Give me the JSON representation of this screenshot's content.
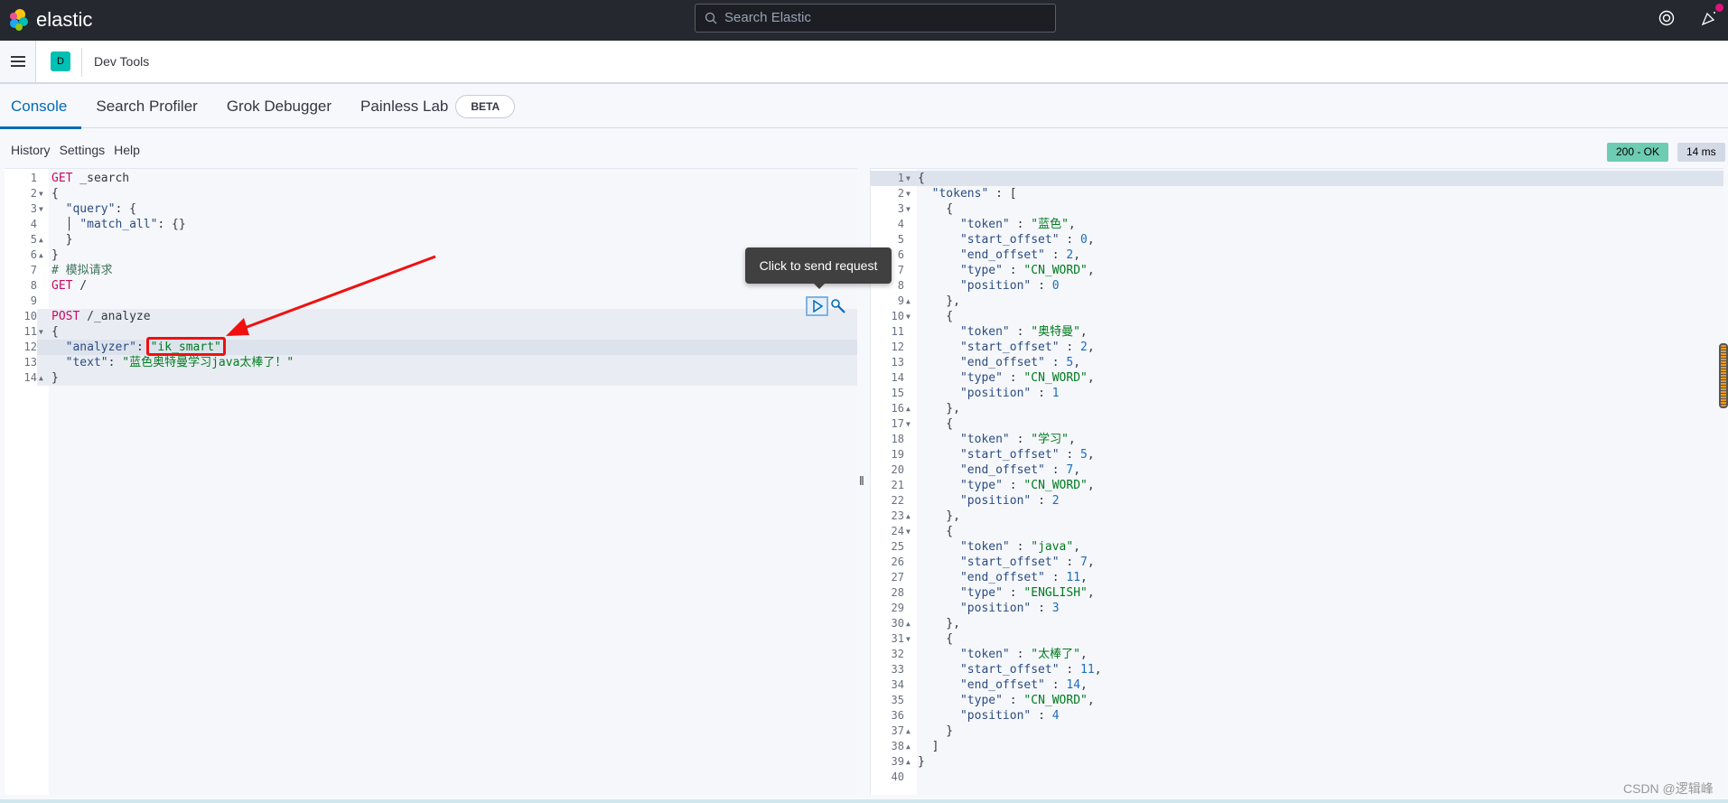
{
  "header": {
    "brand": "elastic",
    "search_placeholder": "Search Elastic"
  },
  "subbar": {
    "space_initial": "D",
    "breadcrumb": "Dev Tools"
  },
  "tabs": [
    {
      "label": "Console"
    },
    {
      "label": "Search Profiler"
    },
    {
      "label": "Grok Debugger"
    },
    {
      "label": "Painless Lab"
    }
  ],
  "beta_badge": "BETA",
  "toolbar": {
    "history": "History",
    "settings": "Settings",
    "help": "Help"
  },
  "response_status": {
    "status": "200 - OK",
    "time": "14 ms",
    "status_color": "#6dccb1"
  },
  "tooltip": "Click to send request",
  "watermark": "CSDN @逻辑峰",
  "request_lines": [
    {
      "n": "1",
      "t": [
        [
          "method",
          "GET"
        ],
        [
          "path",
          " _search"
        ]
      ]
    },
    {
      "n": "2",
      "f": "open",
      "t": [
        [
          "punc",
          "{"
        ]
      ]
    },
    {
      "n": "3",
      "f": "open",
      "t": [
        [
          "punc",
          "  "
        ],
        [
          "key",
          "\"query\""
        ],
        [
          "punc",
          ": {"
        ]
      ]
    },
    {
      "n": "4",
      "t": [
        [
          "punc",
          "  │ "
        ],
        [
          "key",
          "\"match_all\""
        ],
        [
          "punc",
          ": {}"
        ]
      ]
    },
    {
      "n": "5",
      "f": "close",
      "t": [
        [
          "punc",
          "  }"
        ]
      ]
    },
    {
      "n": "6",
      "f": "close",
      "t": [
        [
          "punc",
          "}"
        ]
      ]
    },
    {
      "n": "7",
      "t": [
        [
          "cmt",
          "# 模拟请求"
        ]
      ]
    },
    {
      "n": "8",
      "t": [
        [
          "method",
          "GET"
        ],
        [
          "path",
          " /"
        ]
      ]
    },
    {
      "n": "9",
      "t": []
    },
    {
      "n": "10",
      "hl": "band",
      "t": [
        [
          "method",
          "POST"
        ],
        [
          "path",
          " /_analyze"
        ]
      ]
    },
    {
      "n": "11",
      "hl": "band",
      "f": "open",
      "t": [
        [
          "punc",
          "{"
        ]
      ]
    },
    {
      "n": "12",
      "hl": "cur",
      "t": [
        [
          "punc",
          "  "
        ],
        [
          "key",
          "\"analyzer\""
        ],
        [
          "punc",
          ": "
        ],
        [
          "str",
          "\"ik_smart\""
        ],
        [
          "punc",
          ","
        ]
      ]
    },
    {
      "n": "13",
      "hl": "band",
      "t": [
        [
          "punc",
          "  "
        ],
        [
          "key",
          "\"text\""
        ],
        [
          "punc",
          ": "
        ],
        [
          "str",
          "\"蓝色奥特曼学习java太棒了！\""
        ]
      ]
    },
    {
      "n": "14",
      "hl": "band",
      "f": "close",
      "t": [
        [
          "punc",
          "}"
        ]
      ]
    }
  ],
  "response_lines": [
    {
      "n": "1",
      "f": "open",
      "hl": "cur",
      "t": [
        [
          "punc",
          "{"
        ]
      ]
    },
    {
      "n": "2",
      "f": "open",
      "t": [
        [
          "punc",
          "  "
        ],
        [
          "key",
          "\"tokens\""
        ],
        [
          "punc",
          " : ["
        ]
      ]
    },
    {
      "n": "3",
      "f": "open",
      "t": [
        [
          "punc",
          "    {"
        ]
      ]
    },
    {
      "n": "4",
      "t": [
        [
          "punc",
          "      "
        ],
        [
          "key",
          "\"token\""
        ],
        [
          "punc",
          " : "
        ],
        [
          "str",
          "\"蓝色\""
        ],
        [
          "punc",
          ","
        ]
      ]
    },
    {
      "n": "5",
      "t": [
        [
          "punc",
          "      "
        ],
        [
          "key",
          "\"start_offset\""
        ],
        [
          "punc",
          " : "
        ],
        [
          "num",
          "0"
        ],
        [
          "punc",
          ","
        ]
      ]
    },
    {
      "n": "6",
      "t": [
        [
          "punc",
          "      "
        ],
        [
          "key",
          "\"end_offset\""
        ],
        [
          "punc",
          " : "
        ],
        [
          "num",
          "2"
        ],
        [
          "punc",
          ","
        ]
      ]
    },
    {
      "n": "7",
      "t": [
        [
          "punc",
          "      "
        ],
        [
          "key",
          "\"type\""
        ],
        [
          "punc",
          " : "
        ],
        [
          "str",
          "\"CN_WORD\""
        ],
        [
          "punc",
          ","
        ]
      ]
    },
    {
      "n": "8",
      "t": [
        [
          "punc",
          "      "
        ],
        [
          "key",
          "\"position\""
        ],
        [
          "punc",
          " : "
        ],
        [
          "num",
          "0"
        ]
      ]
    },
    {
      "n": "9",
      "f": "close",
      "t": [
        [
          "punc",
          "    },"
        ]
      ]
    },
    {
      "n": "10",
      "f": "open",
      "t": [
        [
          "punc",
          "    {"
        ]
      ]
    },
    {
      "n": "11",
      "t": [
        [
          "punc",
          "      "
        ],
        [
          "key",
          "\"token\""
        ],
        [
          "punc",
          " : "
        ],
        [
          "str",
          "\"奥特曼\""
        ],
        [
          "punc",
          ","
        ]
      ]
    },
    {
      "n": "12",
      "t": [
        [
          "punc",
          "      "
        ],
        [
          "key",
          "\"start_offset\""
        ],
        [
          "punc",
          " : "
        ],
        [
          "num",
          "2"
        ],
        [
          "punc",
          ","
        ]
      ]
    },
    {
      "n": "13",
      "t": [
        [
          "punc",
          "      "
        ],
        [
          "key",
          "\"end_offset\""
        ],
        [
          "punc",
          " : "
        ],
        [
          "num",
          "5"
        ],
        [
          "punc",
          ","
        ]
      ]
    },
    {
      "n": "14",
      "t": [
        [
          "punc",
          "      "
        ],
        [
          "key",
          "\"type\""
        ],
        [
          "punc",
          " : "
        ],
        [
          "str",
          "\"CN_WORD\""
        ],
        [
          "punc",
          ","
        ]
      ]
    },
    {
      "n": "15",
      "t": [
        [
          "punc",
          "      "
        ],
        [
          "key",
          "\"position\""
        ],
        [
          "punc",
          " : "
        ],
        [
          "num",
          "1"
        ]
      ]
    },
    {
      "n": "16",
      "f": "close",
      "t": [
        [
          "punc",
          "    },"
        ]
      ]
    },
    {
      "n": "17",
      "f": "open",
      "t": [
        [
          "punc",
          "    {"
        ]
      ]
    },
    {
      "n": "18",
      "t": [
        [
          "punc",
          "      "
        ],
        [
          "key",
          "\"token\""
        ],
        [
          "punc",
          " : "
        ],
        [
          "str",
          "\"学习\""
        ],
        [
          "punc",
          ","
        ]
      ]
    },
    {
      "n": "19",
      "t": [
        [
          "punc",
          "      "
        ],
        [
          "key",
          "\"start_offset\""
        ],
        [
          "punc",
          " : "
        ],
        [
          "num",
          "5"
        ],
        [
          "punc",
          ","
        ]
      ]
    },
    {
      "n": "20",
      "t": [
        [
          "punc",
          "      "
        ],
        [
          "key",
          "\"end_offset\""
        ],
        [
          "punc",
          " : "
        ],
        [
          "num",
          "7"
        ],
        [
          "punc",
          ","
        ]
      ]
    },
    {
      "n": "21",
      "t": [
        [
          "punc",
          "      "
        ],
        [
          "key",
          "\"type\""
        ],
        [
          "punc",
          " : "
        ],
        [
          "str",
          "\"CN_WORD\""
        ],
        [
          "punc",
          ","
        ]
      ]
    },
    {
      "n": "22",
      "t": [
        [
          "punc",
          "      "
        ],
        [
          "key",
          "\"position\""
        ],
        [
          "punc",
          " : "
        ],
        [
          "num",
          "2"
        ]
      ]
    },
    {
      "n": "23",
      "f": "close",
      "t": [
        [
          "punc",
          "    },"
        ]
      ]
    },
    {
      "n": "24",
      "f": "open",
      "t": [
        [
          "punc",
          "    {"
        ]
      ]
    },
    {
      "n": "25",
      "t": [
        [
          "punc",
          "      "
        ],
        [
          "key",
          "\"token\""
        ],
        [
          "punc",
          " : "
        ],
        [
          "str",
          "\"java\""
        ],
        [
          "punc",
          ","
        ]
      ]
    },
    {
      "n": "26",
      "t": [
        [
          "punc",
          "      "
        ],
        [
          "key",
          "\"start_offset\""
        ],
        [
          "punc",
          " : "
        ],
        [
          "num",
          "7"
        ],
        [
          "punc",
          ","
        ]
      ]
    },
    {
      "n": "27",
      "t": [
        [
          "punc",
          "      "
        ],
        [
          "key",
          "\"end_offset\""
        ],
        [
          "punc",
          " : "
        ],
        [
          "num",
          "11"
        ],
        [
          "punc",
          ","
        ]
      ]
    },
    {
      "n": "28",
      "t": [
        [
          "punc",
          "      "
        ],
        [
          "key",
          "\"type\""
        ],
        [
          "punc",
          " : "
        ],
        [
          "str",
          "\"ENGLISH\""
        ],
        [
          "punc",
          ","
        ]
      ]
    },
    {
      "n": "29",
      "t": [
        [
          "punc",
          "      "
        ],
        [
          "key",
          "\"position\""
        ],
        [
          "punc",
          " : "
        ],
        [
          "num",
          "3"
        ]
      ]
    },
    {
      "n": "30",
      "f": "close",
      "t": [
        [
          "punc",
          "    },"
        ]
      ]
    },
    {
      "n": "31",
      "f": "open",
      "t": [
        [
          "punc",
          "    {"
        ]
      ]
    },
    {
      "n": "32",
      "t": [
        [
          "punc",
          "      "
        ],
        [
          "key",
          "\"token\""
        ],
        [
          "punc",
          " : "
        ],
        [
          "str",
          "\"太棒了\""
        ],
        [
          "punc",
          ","
        ]
      ]
    },
    {
      "n": "33",
      "t": [
        [
          "punc",
          "      "
        ],
        [
          "key",
          "\"start_offset\""
        ],
        [
          "punc",
          " : "
        ],
        [
          "num",
          "11"
        ],
        [
          "punc",
          ","
        ]
      ]
    },
    {
      "n": "34",
      "t": [
        [
          "punc",
          "      "
        ],
        [
          "key",
          "\"end_offset\""
        ],
        [
          "punc",
          " : "
        ],
        [
          "num",
          "14"
        ],
        [
          "punc",
          ","
        ]
      ]
    },
    {
      "n": "35",
      "t": [
        [
          "punc",
          "      "
        ],
        [
          "key",
          "\"type\""
        ],
        [
          "punc",
          " : "
        ],
        [
          "str",
          "\"CN_WORD\""
        ],
        [
          "punc",
          ","
        ]
      ]
    },
    {
      "n": "36",
      "t": [
        [
          "punc",
          "      "
        ],
        [
          "key",
          "\"position\""
        ],
        [
          "punc",
          " : "
        ],
        [
          "num",
          "4"
        ]
      ]
    },
    {
      "n": "37",
      "f": "close",
      "t": [
        [
          "punc",
          "    }"
        ]
      ]
    },
    {
      "n": "38",
      "f": "close",
      "t": [
        [
          "punc",
          "  ]"
        ]
      ]
    },
    {
      "n": "39",
      "f": "close",
      "t": [
        [
          "punc",
          "}"
        ]
      ]
    },
    {
      "n": "40",
      "t": []
    }
  ]
}
